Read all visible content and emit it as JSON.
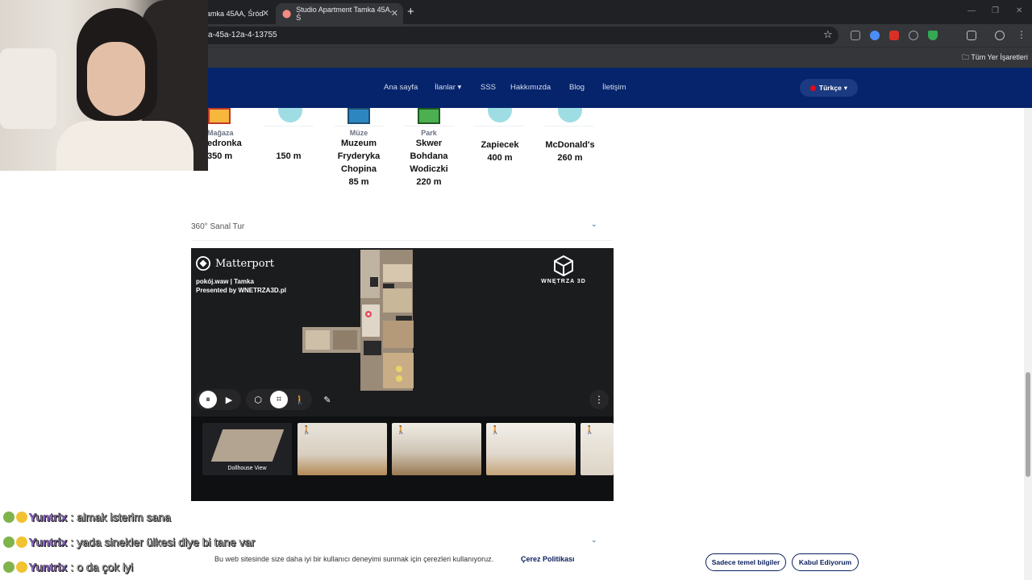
{
  "browser": {
    "tabs": [
      {
        "title": "amka 45AA, Śród"
      },
      {
        "title": "Studio Apartment Tamka 45A, Ś"
      }
    ],
    "url": "a-45a-12a-4-13755",
    "bookmarks_folder": "Tüm Yer İşaretleri"
  },
  "nav": {
    "items": [
      "Ana sayfa",
      "İlanlar",
      "SSS",
      "Hakkımızda",
      "Blog",
      "İletişim"
    ],
    "language": "Türkçe"
  },
  "places": [
    {
      "category": "Mağaza",
      "name": "edronka",
      "distance": "350 m"
    },
    {
      "category": "",
      "name": "",
      "distance": "150 m"
    },
    {
      "category": "Müze",
      "name": "Muzeum Fryderyka Chopina",
      "distance": "85 m"
    },
    {
      "category": "Park",
      "name": "Skwer Bohdana Wodiczki",
      "distance": "220 m"
    },
    {
      "category": "",
      "name": "Zapiecek",
      "distance": "400 m"
    },
    {
      "category": "",
      "name": "McDonald's",
      "distance": "260 m"
    }
  ],
  "tour": {
    "section_title": "360° Sanal Tur",
    "brand": "Matterport",
    "subtitle_line1": "pokój.waw | Tamka",
    "subtitle_line2": "Presented by WNETRZA3D.pl",
    "partner_logo": "WNĘTRZA 3D",
    "dollhouse_label": "Dollhouse View"
  },
  "cookie": {
    "text": "Bu web sitesinde size daha iyi bir kullanıcı deneyimi sunmak için çerezleri kullanıyoruz.",
    "policy_link": "Çerez Politikası",
    "basic_button": "Sadece temel bilgiler",
    "accept_button": "Kabul Ediyorum"
  },
  "chat": [
    {
      "user": "Yuntrix",
      "message": ": almak isterim sana"
    },
    {
      "user": "Yuntrix",
      "message": ": yada sinekler ülkesi diye bi tane var"
    },
    {
      "user": "Yuntrix",
      "message": ": o da çok iyi"
    }
  ],
  "colors": {
    "nav_bg": "#05246b",
    "chat_user": "#a36cf5",
    "cookie_accent": "#0b1f5c"
  }
}
